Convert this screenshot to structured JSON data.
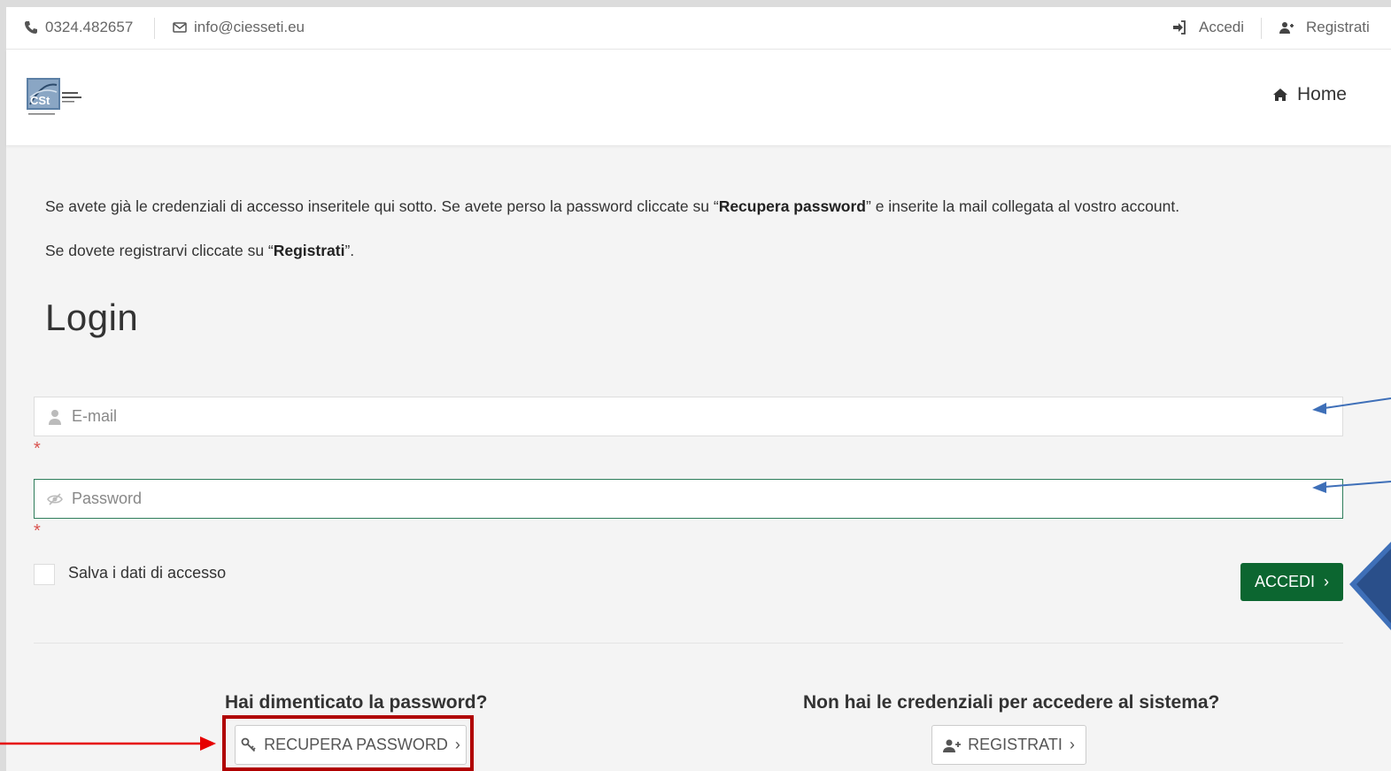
{
  "topbar": {
    "phone": "0324.482657",
    "email": "info@ciesseti.eu",
    "login": "Accedi",
    "register": "Registrati"
  },
  "header": {
    "logo_text": "CSt",
    "home": "Home"
  },
  "intro": {
    "line1_pre": "Se avete già le credenziali di accesso inseritele qui sotto. Se avete perso la password cliccate su “",
    "line1_bold": "Recupera password",
    "line1_post": "” e inserite la mail collegata al vostro account.",
    "line2_pre": "Se dovete registrarvi cliccate su “",
    "line2_bold": "Registrati",
    "line2_post": "”."
  },
  "login": {
    "title": "Login",
    "email_placeholder": "E-mail",
    "password_placeholder": "Password",
    "required_mark": "*",
    "remember_label": "Salva i dati di accesso",
    "submit_label": "ACCEDI",
    "submit_chevron": "›"
  },
  "forgot": {
    "title": "Hai dimenticato la password?",
    "button": "RECUPERA PASSWORD",
    "chevron": "›"
  },
  "signup": {
    "title": "Non hai le credenziali per accedere al sistema?",
    "button": "REGISTRATI",
    "chevron": "›"
  },
  "colors": {
    "accent_green": "#0c6630",
    "annotation_blue": "#3e6fb8",
    "annotation_red": "#b00000"
  }
}
